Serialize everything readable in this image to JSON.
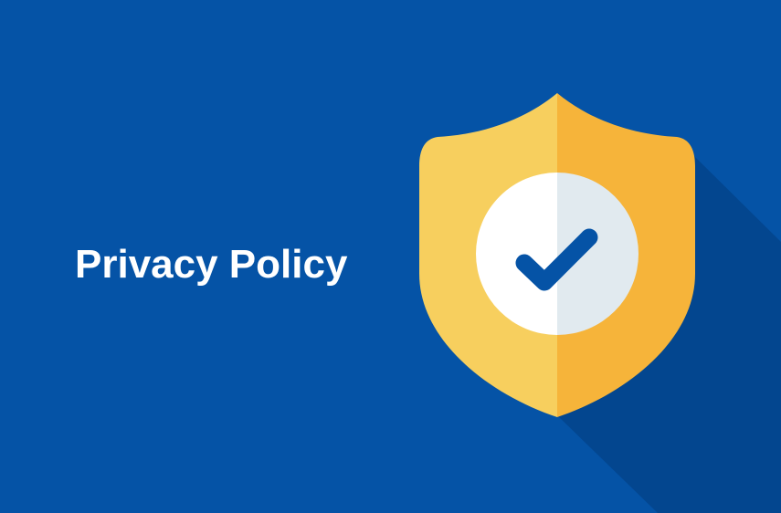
{
  "banner": {
    "title": "Privacy Policy",
    "icon": "shield-check-icon",
    "colors": {
      "background": "#0553A6",
      "shadow": "#03468F",
      "shield_left": "#F7CF5E",
      "shield_right": "#F6B43A",
      "circle_left": "#FFFFFF",
      "circle_right": "#E1EAEF",
      "checkmark": "#0553A6",
      "title_text": "#FFFFFF"
    }
  }
}
